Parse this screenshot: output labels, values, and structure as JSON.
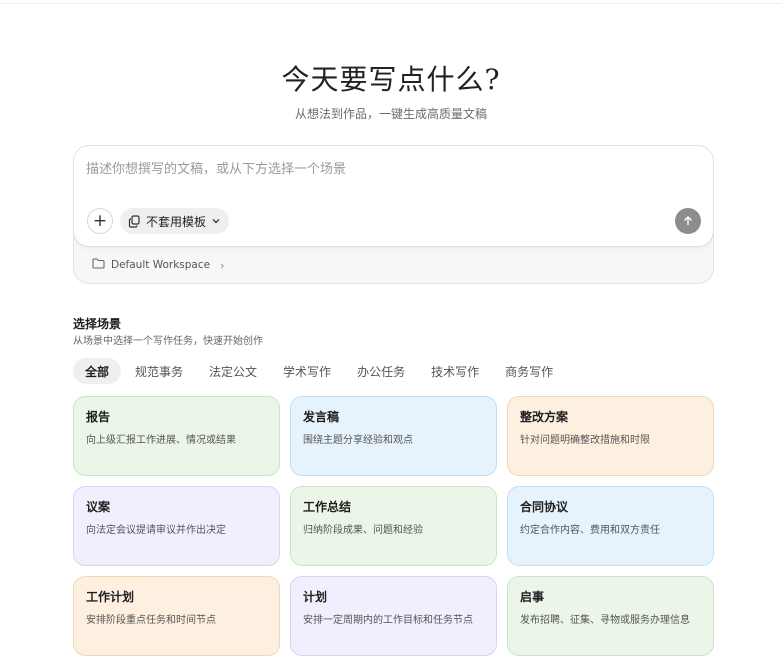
{
  "hero": {
    "title": "今天要写点什么?",
    "subtitle": "从想法到作品，一键生成高质量文稿"
  },
  "composer": {
    "placeholder": "描述你想撰写的文稿，或从下方选择一个场景",
    "template_label": "不套用模板",
    "workspace_label": "Default Workspace"
  },
  "scenes": {
    "title": "选择场景",
    "subtitle": "从场景中选择一个写作任务，快速开始创作",
    "tabs": [
      "全部",
      "规范事务",
      "法定公文",
      "学术写作",
      "办公任务",
      "技术写作",
      "商务写作"
    ],
    "active_tab": "全部",
    "cards": [
      {
        "title": "报告",
        "desc": "向上级汇报工作进展、情况或结果",
        "color": "#ebf6e8"
      },
      {
        "title": "发言稿",
        "desc": "围绕主题分享经验和观点",
        "color": "#e7f3fc"
      },
      {
        "title": "整改方案",
        "desc": "针对问题明确整改措施和时限",
        "color": "#fdf0e0"
      },
      {
        "title": "议案",
        "desc": "向法定会议提请审议并作出决定",
        "color": "#f1effd"
      },
      {
        "title": "工作总结",
        "desc": "归纳阶段成果、问题和经验",
        "color": "#ebf6e8"
      },
      {
        "title": "合同协议",
        "desc": "约定合作内容、费用和双方责任",
        "color": "#e7f3fc"
      },
      {
        "title": "工作计划",
        "desc": "安排阶段重点任务和时间节点",
        "color": "#fdf0e0"
      },
      {
        "title": "计划",
        "desc": "安排一定周期内的工作目标和任务节点",
        "color": "#f1effd"
      },
      {
        "title": "启事",
        "desc": "发布招聘、征集、寻物或服务办理信息",
        "color": "#ebf6e8"
      }
    ]
  },
  "icons": {
    "plus": "plus-icon",
    "template": "copy-template-icon",
    "chevron": "chevron-down-icon",
    "send": "arrow-up-icon",
    "folder": "folder-icon",
    "workspace_chevron": "chevron-right-icon"
  }
}
